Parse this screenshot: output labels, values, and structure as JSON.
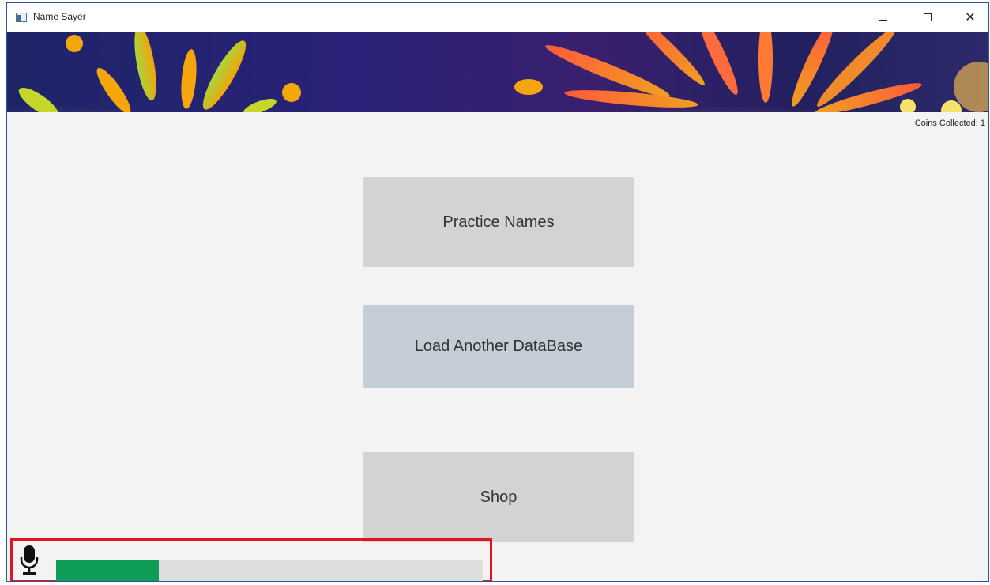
{
  "window": {
    "title": "Name Sayer",
    "controls": {
      "minimize": "minimize",
      "maximize": "maximize",
      "close": "close"
    }
  },
  "status": {
    "coins_label": "Coins Collected: 1"
  },
  "menu": {
    "practice_label": "Practice Names",
    "load_label": "Load Another DataBase",
    "shop_label": "Shop"
  },
  "mic": {
    "icon": "microphone-icon",
    "level_fraction": 0.24
  },
  "colors": {
    "accent_red": "#e0161e",
    "level_green": "#0f9d58",
    "button_grey": "#d3d3d3",
    "button_blue_grey": "#c5cdd6"
  }
}
